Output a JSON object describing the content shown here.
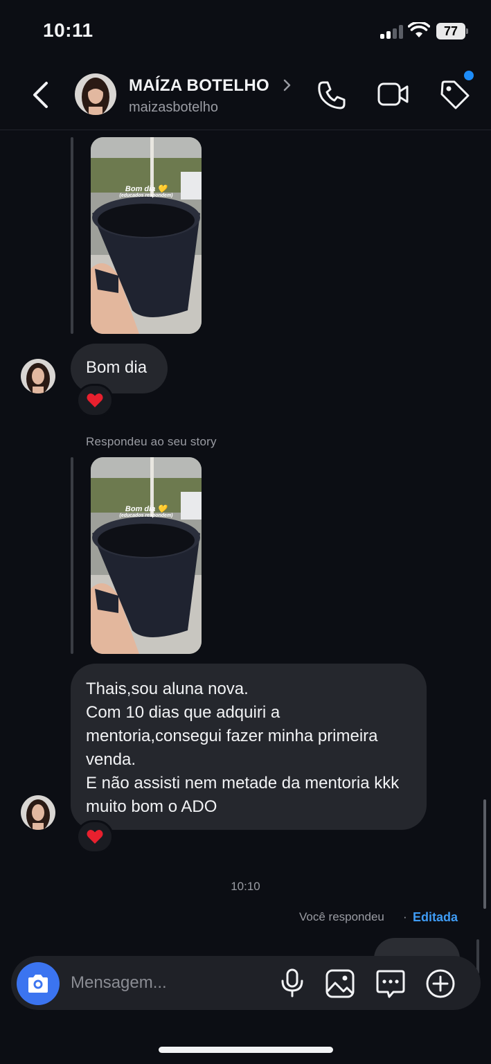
{
  "status_bar": {
    "time": "10:11",
    "battery": "77"
  },
  "header": {
    "contact_name": "MAÍZA BOTELHO",
    "contact_username": "maizasbotelho",
    "has_notification": true
  },
  "chat": {
    "story_1": {
      "caption": "Bom dia 💛",
      "caption_sub": "(educados respondem)"
    },
    "message_1": {
      "text": "Bom dia",
      "reaction": "❤️"
    },
    "reply_label": "Respondeu ao seu story",
    "story_2": {
      "caption": "Bom dia 💛",
      "caption_sub": "(educados respondem)"
    },
    "message_2": {
      "paragraph_1": "Thais,sou aluna nova.",
      "paragraph_2": "Com 10 dias que adquiri a mentoria,consegui fazer minha primeira venda.",
      "paragraph_3": "E não assisti nem metade da mentoria kkk muito bom o ADO",
      "reaction": "❤️"
    },
    "timestamp": "10:10",
    "you_replied": "Você respondeu",
    "separator": "·",
    "edited": "Editada"
  },
  "composer": {
    "placeholder": "Mensagem..."
  },
  "colors": {
    "background": "#0c0e14",
    "bubble": "#25272d",
    "accent_blue": "#3b74f0",
    "edited_link": "#3f9cf5",
    "reaction_heart": "#e8202e"
  },
  "icons": [
    "back-arrow-icon",
    "chevron-right-icon",
    "phone-icon",
    "video-camera-icon",
    "tag-icon",
    "camera-icon",
    "microphone-icon",
    "gallery-icon",
    "sticker-icon",
    "plus-icon",
    "heart-icon",
    "signal-icon",
    "wifi-icon",
    "battery-icon"
  ]
}
